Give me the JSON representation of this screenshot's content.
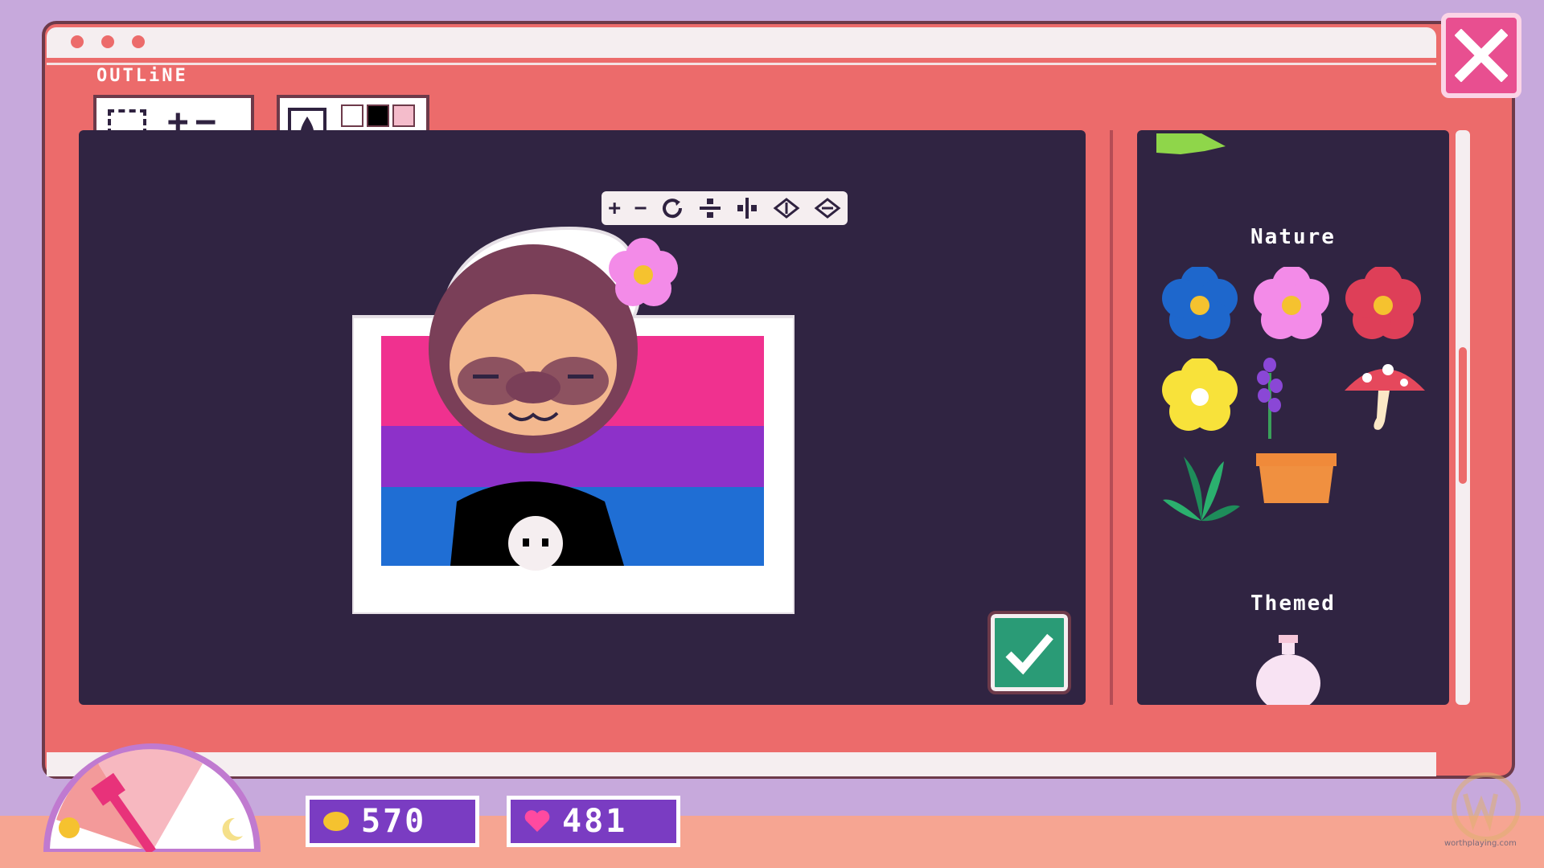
{
  "window": {
    "title": "OUTLiNE",
    "close_label": "close"
  },
  "tools": {
    "select_plus": "+",
    "select_minus": "−",
    "palette": [
      "#ffffff",
      "#000000",
      "#f4bccb",
      "#fff4b8",
      "#c9f0b0",
      "#bfe9ff"
    ]
  },
  "transform_toolbar": {
    "plus": "+",
    "minus": "−"
  },
  "sticker": {
    "flag_colors": [
      "#f0318f",
      "#8d31c9",
      "#1f6ed4"
    ]
  },
  "library": {
    "categories": [
      {
        "label": "Nature",
        "items": [
          "blue-flower",
          "pink-flower",
          "red-flower",
          "yellow-flower",
          "lavender",
          "mushroom",
          "leaves",
          "planter"
        ]
      },
      {
        "label": "Themed",
        "items": [
          "potion-bottle"
        ]
      }
    ]
  },
  "hud": {
    "coins": "570",
    "hearts": "481"
  },
  "watermark": {
    "text": "worthplaying.com"
  }
}
